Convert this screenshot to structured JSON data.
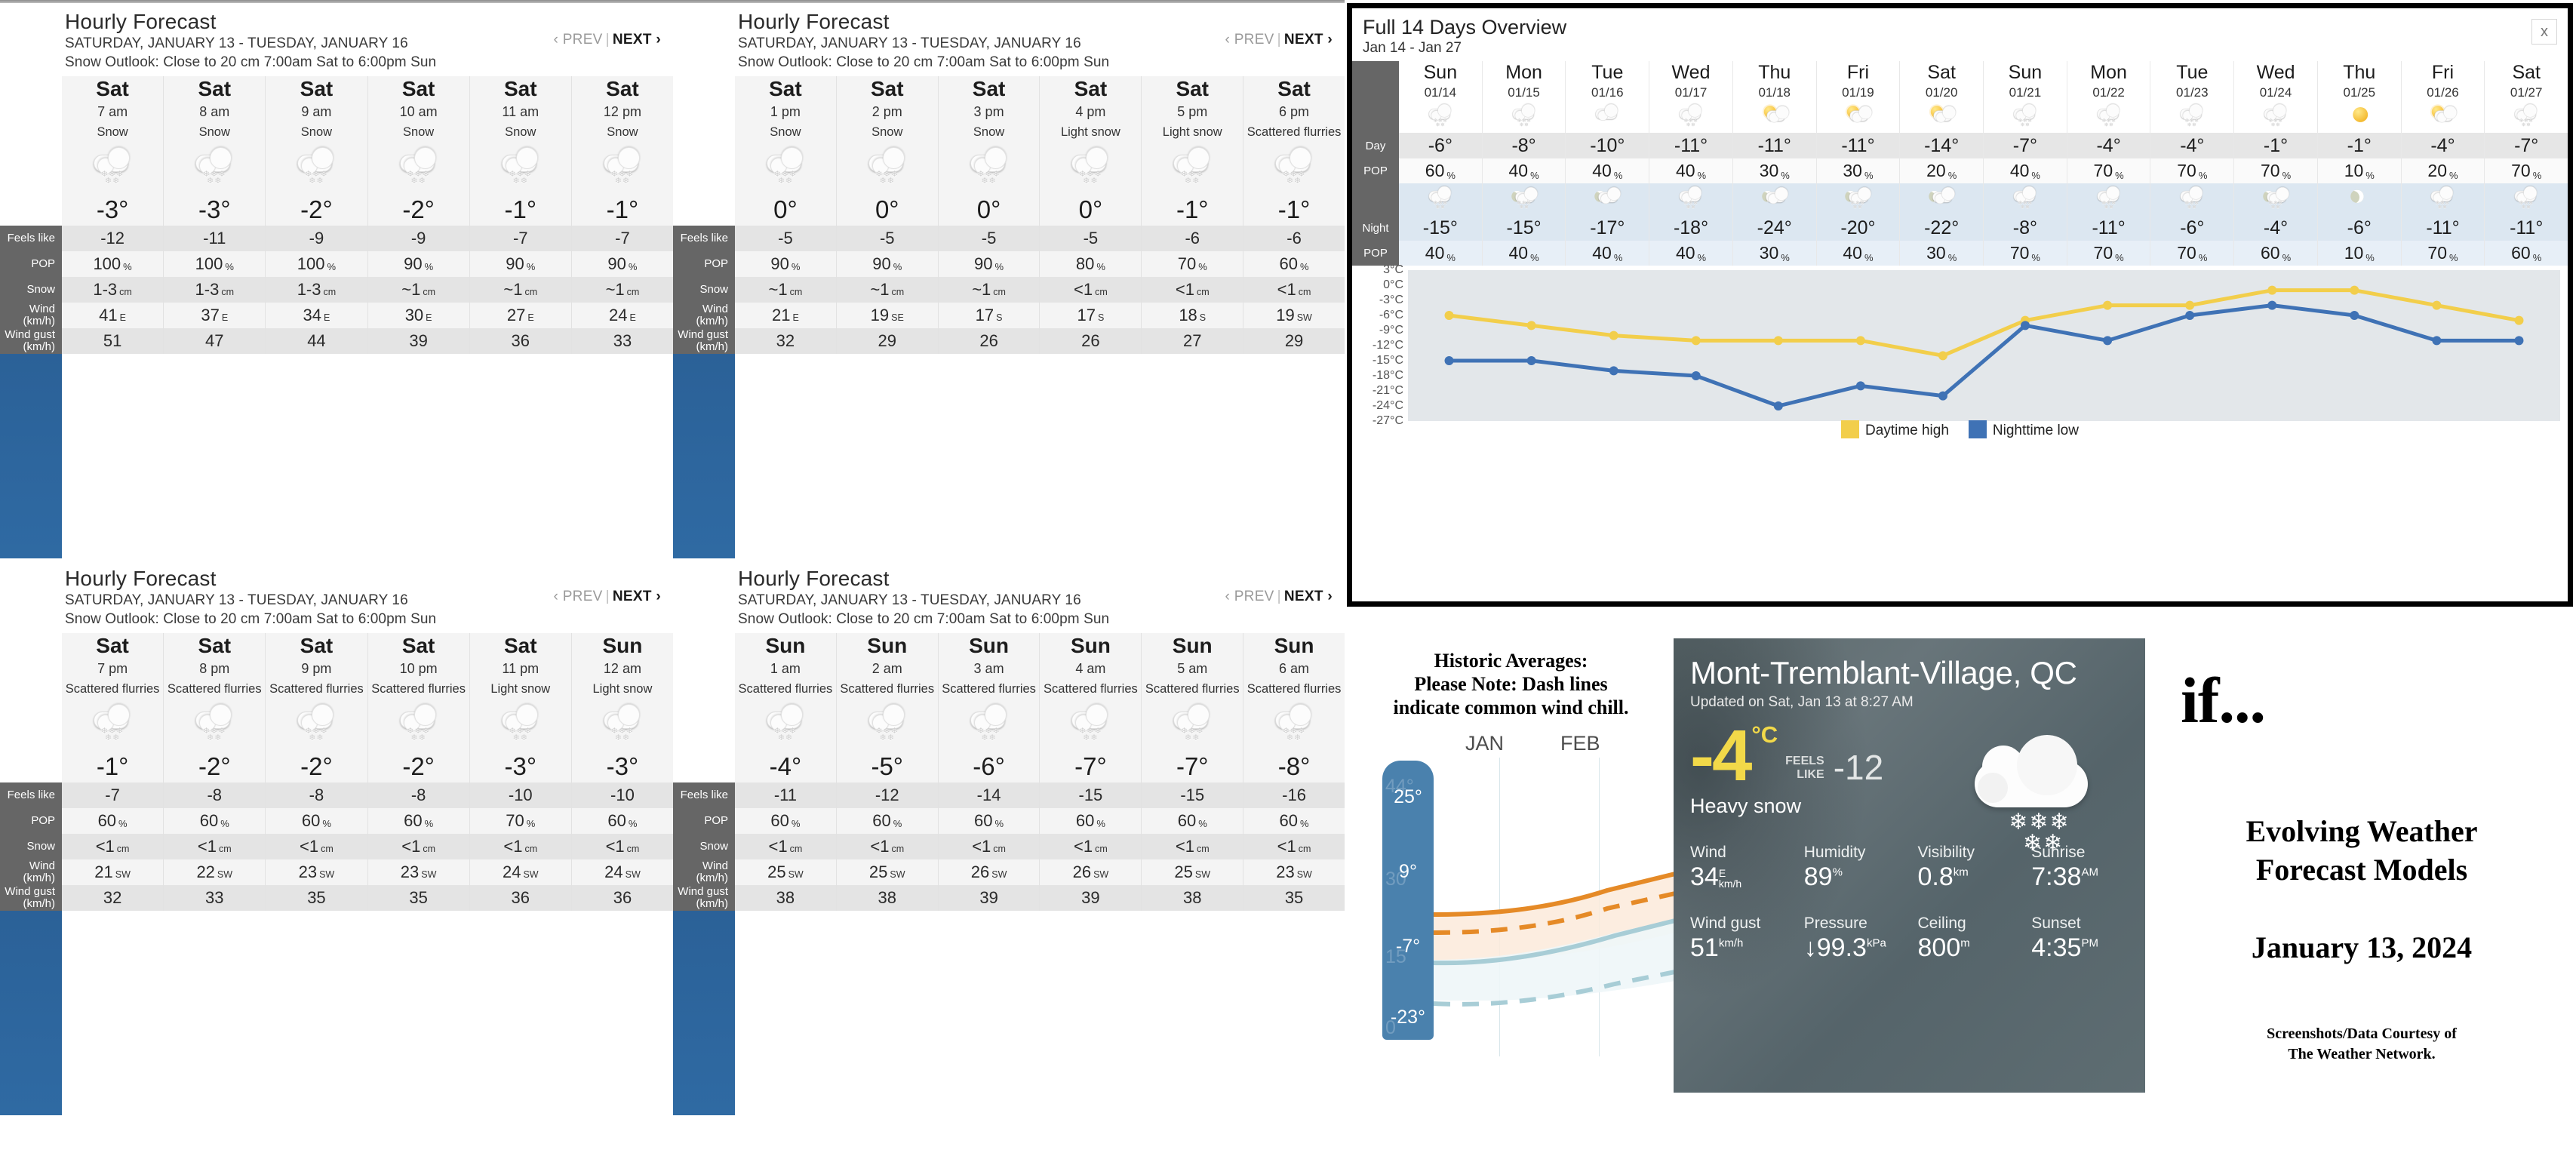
{
  "hourly_panels": [
    {
      "title": "Hourly Forecast",
      "range": "SATURDAY, JANUARY 13 - TUESDAY, JANUARY 16",
      "outlook": "Snow Outlook: Close to 20 cm 7:00am Sat to 6:00pm Sun",
      "prev_label": "‹ PREV",
      "next_label": "NEXT ›",
      "row_labels": [
        "Feels like",
        "POP",
        "Snow",
        "Wind (km/h)",
        "Wind gust (km/h)"
      ],
      "columns": [
        {
          "day": "Sat",
          "hour": "7 am",
          "cond": "Snow",
          "icon": "snow",
          "temp": "-3",
          "feels": "-12",
          "pop": "100",
          "pop_unit": "%",
          "snow": "1-3",
          "snow_unit": "cm",
          "wind": "41",
          "wind_dir": "E",
          "gust": "51"
        },
        {
          "day": "Sat",
          "hour": "8 am",
          "cond": "Snow",
          "icon": "snow",
          "temp": "-3",
          "feels": "-11",
          "pop": "100",
          "pop_unit": "%",
          "snow": "1-3",
          "snow_unit": "cm",
          "wind": "37",
          "wind_dir": "E",
          "gust": "47"
        },
        {
          "day": "Sat",
          "hour": "9 am",
          "cond": "Snow",
          "icon": "snow",
          "temp": "-2",
          "feels": "-9",
          "pop": "100",
          "pop_unit": "%",
          "snow": "1-3",
          "snow_unit": "cm",
          "wind": "34",
          "wind_dir": "E",
          "gust": "44"
        },
        {
          "day": "Sat",
          "hour": "10 am",
          "cond": "Snow",
          "icon": "snow",
          "temp": "-2",
          "feels": "-9",
          "pop": "90",
          "pop_unit": "%",
          "snow": "~1",
          "snow_unit": "cm",
          "wind": "30",
          "wind_dir": "E",
          "gust": "39"
        },
        {
          "day": "Sat",
          "hour": "11 am",
          "cond": "Snow",
          "icon": "snow",
          "temp": "-1",
          "feels": "-7",
          "pop": "90",
          "pop_unit": "%",
          "snow": "~1",
          "snow_unit": "cm",
          "wind": "27",
          "wind_dir": "E",
          "gust": "36"
        },
        {
          "day": "Sat",
          "hour": "12 pm",
          "cond": "Snow",
          "icon": "snow",
          "temp": "-1",
          "feels": "-7",
          "pop": "90",
          "pop_unit": "%",
          "snow": "~1",
          "snow_unit": "cm",
          "wind": "24",
          "wind_dir": "E",
          "gust": "33"
        }
      ]
    },
    {
      "title": "Hourly Forecast",
      "range": "SATURDAY, JANUARY 13 - TUESDAY, JANUARY 16",
      "outlook": "Snow Outlook: Close to 20 cm 7:00am Sat to 6:00pm Sun",
      "prev_label": "‹ PREV",
      "next_label": "NEXT ›",
      "row_labels": [
        "Feels like",
        "POP",
        "Snow",
        "Wind (km/h)",
        "Wind gust (km/h)"
      ],
      "columns": [
        {
          "day": "Sat",
          "hour": "1 pm",
          "cond": "Snow",
          "icon": "snow",
          "temp": "0",
          "feels": "-5",
          "pop": "90",
          "pop_unit": "%",
          "snow": "~1",
          "snow_unit": "cm",
          "wind": "21",
          "wind_dir": "E",
          "gust": "32"
        },
        {
          "day": "Sat",
          "hour": "2 pm",
          "cond": "Snow",
          "icon": "snow",
          "temp": "0",
          "feels": "-5",
          "pop": "90",
          "pop_unit": "%",
          "snow": "~1",
          "snow_unit": "cm",
          "wind": "19",
          "wind_dir": "SE",
          "gust": "29"
        },
        {
          "day": "Sat",
          "hour": "3 pm",
          "cond": "Snow",
          "icon": "snow",
          "temp": "0",
          "feels": "-5",
          "pop": "90",
          "pop_unit": "%",
          "snow": "~1",
          "snow_unit": "cm",
          "wind": "17",
          "wind_dir": "S",
          "gust": "26"
        },
        {
          "day": "Sat",
          "hour": "4 pm",
          "cond": "Light snow",
          "icon": "snow",
          "temp": "0",
          "feels": "-5",
          "pop": "80",
          "pop_unit": "%",
          "snow": "<1",
          "snow_unit": "cm",
          "wind": "17",
          "wind_dir": "S",
          "gust": "26"
        },
        {
          "day": "Sat",
          "hour": "5 pm",
          "cond": "Light snow",
          "icon": "snow",
          "temp": "-1",
          "feels": "-6",
          "pop": "70",
          "pop_unit": "%",
          "snow": "<1",
          "snow_unit": "cm",
          "wind": "18",
          "wind_dir": "S",
          "gust": "27"
        },
        {
          "day": "Sat",
          "hour": "6 pm",
          "cond": "Scattered flurries",
          "icon": "snow",
          "temp": "-1",
          "feels": "-6",
          "pop": "60",
          "pop_unit": "%",
          "snow": "<1",
          "snow_unit": "cm",
          "wind": "19",
          "wind_dir": "SW",
          "gust": "29"
        }
      ]
    },
    {
      "title": "Hourly Forecast",
      "range": "SATURDAY, JANUARY 13 - TUESDAY, JANUARY 16",
      "outlook": "Snow Outlook: Close to 20 cm 7:00am Sat to 6:00pm Sun",
      "prev_label": "‹ PREV",
      "next_label": "NEXT ›",
      "row_labels": [
        "Feels like",
        "POP",
        "Snow",
        "Wind (km/h)",
        "Wind gust (km/h)"
      ],
      "columns": [
        {
          "day": "Sat",
          "hour": "7 pm",
          "cond": "Scattered flurries",
          "icon": "snow",
          "temp": "-1",
          "feels": "-7",
          "pop": "60",
          "pop_unit": "%",
          "snow": "<1",
          "snow_unit": "cm",
          "wind": "21",
          "wind_dir": "SW",
          "gust": "32"
        },
        {
          "day": "Sat",
          "hour": "8 pm",
          "cond": "Scattered flurries",
          "icon": "snow",
          "temp": "-2",
          "feels": "-8",
          "pop": "60",
          "pop_unit": "%",
          "snow": "<1",
          "snow_unit": "cm",
          "wind": "22",
          "wind_dir": "SW",
          "gust": "33"
        },
        {
          "day": "Sat",
          "hour": "9 pm",
          "cond": "Scattered flurries",
          "icon": "snow",
          "temp": "-2",
          "feels": "-8",
          "pop": "60",
          "pop_unit": "%",
          "snow": "<1",
          "snow_unit": "cm",
          "wind": "23",
          "wind_dir": "SW",
          "gust": "35"
        },
        {
          "day": "Sat",
          "hour": "10 pm",
          "cond": "Scattered flurries",
          "icon": "snow",
          "temp": "-2",
          "feels": "-8",
          "pop": "60",
          "pop_unit": "%",
          "snow": "<1",
          "snow_unit": "cm",
          "wind": "23",
          "wind_dir": "SW",
          "gust": "35"
        },
        {
          "day": "Sat",
          "hour": "11 pm",
          "cond": "Light snow",
          "icon": "snow",
          "temp": "-3",
          "feels": "-10",
          "pop": "70",
          "pop_unit": "%",
          "snow": "<1",
          "snow_unit": "cm",
          "wind": "24",
          "wind_dir": "SW",
          "gust": "36"
        },
        {
          "day": "Sun",
          "hour": "12 am",
          "cond": "Light snow",
          "icon": "snow",
          "temp": "-3",
          "feels": "-10",
          "pop": "60",
          "pop_unit": "%",
          "snow": "<1",
          "snow_unit": "cm",
          "wind": "24",
          "wind_dir": "SW",
          "gust": "36"
        }
      ]
    },
    {
      "title": "Hourly Forecast",
      "range": "SATURDAY, JANUARY 13 - TUESDAY, JANUARY 16",
      "outlook": "Snow Outlook: Close to 20 cm 7:00am Sat to 6:00pm Sun",
      "prev_label": "‹ PREV",
      "next_label": "NEXT ›",
      "row_labels": [
        "Feels like",
        "POP",
        "Snow",
        "Wind (km/h)",
        "Wind gust (km/h)"
      ],
      "columns": [
        {
          "day": "Sun",
          "hour": "1 am",
          "cond": "Scattered flurries",
          "icon": "snow",
          "temp": "-4",
          "feels": "-11",
          "pop": "60",
          "pop_unit": "%",
          "snow": "<1",
          "snow_unit": "cm",
          "wind": "25",
          "wind_dir": "SW",
          "gust": "38"
        },
        {
          "day": "Sun",
          "hour": "2 am",
          "cond": "Scattered flurries",
          "icon": "snow",
          "temp": "-5",
          "feels": "-12",
          "pop": "60",
          "pop_unit": "%",
          "snow": "<1",
          "snow_unit": "cm",
          "wind": "25",
          "wind_dir": "SW",
          "gust": "38"
        },
        {
          "day": "Sun",
          "hour": "3 am",
          "cond": "Scattered flurries",
          "icon": "snow",
          "temp": "-6",
          "feels": "-14",
          "pop": "60",
          "pop_unit": "%",
          "snow": "<1",
          "snow_unit": "cm",
          "wind": "26",
          "wind_dir": "SW",
          "gust": "39"
        },
        {
          "day": "Sun",
          "hour": "4 am",
          "cond": "Scattered flurries",
          "icon": "snow",
          "temp": "-7",
          "feels": "-15",
          "pop": "60",
          "pop_unit": "%",
          "snow": "<1",
          "snow_unit": "cm",
          "wind": "26",
          "wind_dir": "SW",
          "gust": "39"
        },
        {
          "day": "Sun",
          "hour": "5 am",
          "cond": "Scattered flurries",
          "icon": "snow",
          "temp": "-7",
          "feels": "-15",
          "pop": "60",
          "pop_unit": "%",
          "snow": "<1",
          "snow_unit": "cm",
          "wind": "25",
          "wind_dir": "SW",
          "gust": "38"
        },
        {
          "day": "Sun",
          "hour": "6 am",
          "cond": "Scattered flurries",
          "icon": "snow",
          "temp": "-8",
          "feels": "-16",
          "pop": "60",
          "pop_unit": "%",
          "snow": "<1",
          "snow_unit": "cm",
          "wind": "23",
          "wind_dir": "SW",
          "gust": "35"
        }
      ]
    }
  ],
  "overview": {
    "title": "Full 14 Days Overview",
    "subtitle": "Jan 14 - Jan 27",
    "close_label": "x",
    "row_labels": {
      "day": "Day",
      "pop": "POP",
      "night": "Night",
      "npop": "POP"
    },
    "days": [
      {
        "name": "Sun",
        "date": "01/14",
        "day_icon": "snow",
        "day_temp": "-6°",
        "pop": "60",
        "night_icon": "snow",
        "night_temp": "-15°",
        "npop": "40"
      },
      {
        "name": "Mon",
        "date": "01/15",
        "day_icon": "snow",
        "day_temp": "-8°",
        "pop": "40",
        "night_icon": "moon-snow",
        "night_temp": "-15°",
        "npop": "40"
      },
      {
        "name": "Tue",
        "date": "01/16",
        "day_icon": "cloud",
        "day_temp": "-10°",
        "pop": "40",
        "night_icon": "moon-cloud",
        "night_temp": "-17°",
        "npop": "40"
      },
      {
        "name": "Wed",
        "date": "01/17",
        "day_icon": "snow",
        "day_temp": "-11°",
        "pop": "40",
        "night_icon": "snow",
        "night_temp": "-18°",
        "npop": "40"
      },
      {
        "name": "Thu",
        "date": "01/18",
        "day_icon": "sun-cloud",
        "day_temp": "-11°",
        "pop": "30",
        "night_icon": "moon-cloud",
        "night_temp": "-24°",
        "npop": "30"
      },
      {
        "name": "Fri",
        "date": "01/19",
        "day_icon": "sun-cloud",
        "day_temp": "-11°",
        "pop": "30",
        "night_icon": "moon-snow",
        "night_temp": "-20°",
        "npop": "40"
      },
      {
        "name": "Sat",
        "date": "01/20",
        "day_icon": "sun-cloud",
        "day_temp": "-14°",
        "pop": "20",
        "night_icon": "moon-cloud",
        "night_temp": "-22°",
        "npop": "30"
      },
      {
        "name": "Sun",
        "date": "01/21",
        "day_icon": "snow",
        "day_temp": "-7°",
        "pop": "40",
        "night_icon": "snow",
        "night_temp": "-8°",
        "npop": "70"
      },
      {
        "name": "Mon",
        "date": "01/22",
        "day_icon": "snow",
        "day_temp": "-4°",
        "pop": "70",
        "night_icon": "snow",
        "night_temp": "-11°",
        "npop": "70"
      },
      {
        "name": "Tue",
        "date": "01/23",
        "day_icon": "snow",
        "day_temp": "-4°",
        "pop": "70",
        "night_icon": "snow",
        "night_temp": "-6°",
        "npop": "70"
      },
      {
        "name": "Wed",
        "date": "01/24",
        "day_icon": "snow",
        "day_temp": "-1°",
        "pop": "70",
        "night_icon": "moon-snow",
        "night_temp": "-4°",
        "npop": "60"
      },
      {
        "name": "Thu",
        "date": "01/25",
        "day_icon": "sun",
        "day_temp": "-1°",
        "pop": "10",
        "night_icon": "moon",
        "night_temp": "-6°",
        "npop": "10"
      },
      {
        "name": "Fri",
        "date": "01/26",
        "day_icon": "sun-cloud",
        "day_temp": "-4°",
        "pop": "20",
        "night_icon": "snow",
        "night_temp": "-11°",
        "npop": "70"
      },
      {
        "name": "Sat",
        "date": "01/27",
        "day_icon": "snow",
        "day_temp": "-7°",
        "pop": "70",
        "night_icon": "snow",
        "night_temp": "-11°",
        "npop": "60"
      }
    ],
    "legend": [
      {
        "label": "Daytime high",
        "color": "#f2ce4b"
      },
      {
        "label": "Nighttime low",
        "color": "#3f72b5"
      }
    ]
  },
  "chart_data": {
    "type": "line",
    "title": "Full 14 Days Overview",
    "xlabel": "",
    "ylabel": "°C",
    "ylim": [
      -27,
      3
    ],
    "grid": false,
    "legend_position": "bottom",
    "tick_labels": [
      "3°C",
      "0°C",
      "-3°C",
      "-6°C",
      "-9°C",
      "-12°C",
      "-15°C",
      "-18°C",
      "-21°C",
      "-24°C",
      "-27°C"
    ],
    "x": [
      "01/14",
      "01/15",
      "01/16",
      "01/17",
      "01/18",
      "01/19",
      "01/20",
      "01/21",
      "01/22",
      "01/23",
      "01/24",
      "01/25",
      "01/26",
      "01/27"
    ],
    "series": [
      {
        "name": "Daytime high",
        "color": "#f2ce4b",
        "values": [
          -6,
          -8,
          -10,
          -11,
          -11,
          -11,
          -14,
          -7,
          -4,
          -4,
          -1,
          -1,
          -4,
          -7
        ]
      },
      {
        "name": "Nighttime low",
        "color": "#3f72b5",
        "values": [
          -15,
          -15,
          -17,
          -18,
          -24,
          -20,
          -22,
          -8,
          -11,
          -6,
          -4,
          -6,
          -11,
          -11
        ]
      }
    ]
  },
  "historic": {
    "note_line1": "Historic Averages:",
    "note_line2": "Please Note: Dash lines",
    "note_line3": "indicate common wind chill.",
    "months": [
      "JAN",
      "FEB"
    ],
    "scale": [
      {
        "value": "25°",
        "ghost": "44°"
      },
      {
        "value": "9°",
        "ghost": "30"
      },
      {
        "value": "-7°",
        "ghost": "15"
      },
      {
        "value": "-23°",
        "ghost": "0"
      }
    ]
  },
  "current": {
    "city": "Mont-Tremblant-Village, QC",
    "updated": "Updated on Sat, Jan 13 at 8:27 AM",
    "temp": "-4",
    "unit": "°C",
    "feels_like_label_1": "FEELS",
    "feels_like_label_2": "LIKE",
    "feels_like_value": "-12",
    "condition": "Heavy snow",
    "icon": "heavy-snow",
    "stats": [
      {
        "label": "Wind",
        "value": "34",
        "unit_top": "E",
        "unit_bottom": "km/h"
      },
      {
        "label": "Humidity",
        "value": "89",
        "unit_top": "%",
        "unit_bottom": ""
      },
      {
        "label": "Visibility",
        "value": "0.8",
        "unit_top": "km",
        "unit_bottom": ""
      },
      {
        "label": "Sunrise",
        "value": "7:38",
        "unit_top": "AM",
        "unit_bottom": ""
      },
      {
        "label": "Wind gust",
        "value": "51",
        "unit_top": "km/h",
        "unit_bottom": ""
      },
      {
        "label": "Pressure",
        "value": "↓99.3",
        "unit_top": "kPa",
        "unit_bottom": ""
      },
      {
        "label": "Ceiling",
        "value": "800",
        "unit_top": "m",
        "unit_bottom": ""
      },
      {
        "label": "Sunset",
        "value": "4:35",
        "unit_top": "PM",
        "unit_bottom": ""
      }
    ]
  },
  "right_panel": {
    "if_text": "if...",
    "heading_line1": "Evolving Weather",
    "heading_line2": "Forecast Models",
    "date": "January 13, 2024",
    "credit_line1": "Screenshots/Data Courtesy of",
    "credit_line2": "The Weather Network."
  }
}
